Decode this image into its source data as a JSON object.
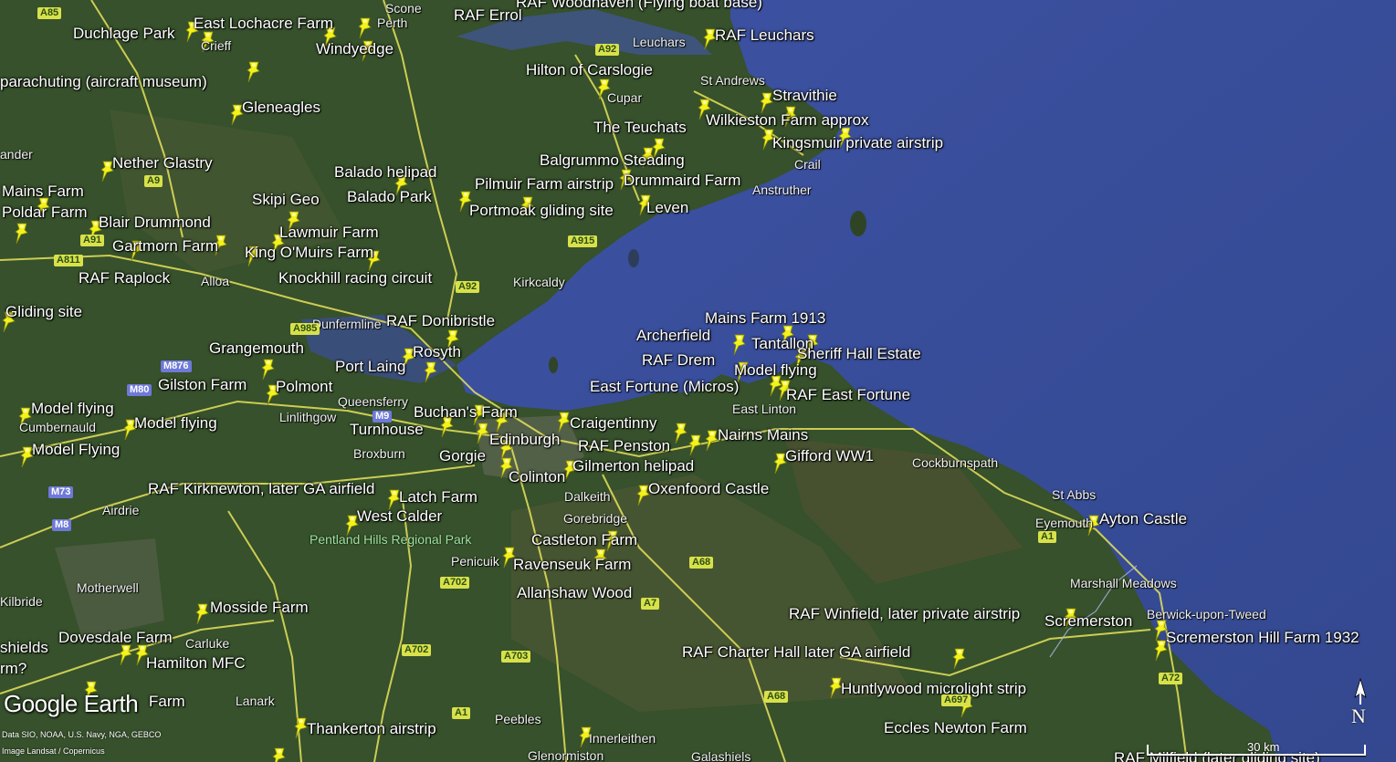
{
  "colors": {
    "sea": "#3a4f9e",
    "land": "#34502a",
    "pin": "#f3f21a",
    "road": "#ece85a"
  },
  "labels": [
    {
      "text": "Duchlage Park"
    },
    {
      "text": "East Lochacre Farm"
    },
    {
      "text": "Windyedge"
    },
    {
      "text": "RAF Errol"
    },
    {
      "text": "RAF Woodhaven (Flying boat base)"
    },
    {
      "text": "RAF Leuchars"
    },
    {
      "text": "Hilton of Carslogie"
    },
    {
      "text": "parachuting (aircraft museum)"
    },
    {
      "text": "Gleneagles"
    },
    {
      "text": "Stravithie"
    },
    {
      "text": "Wilkieston Farm approx"
    },
    {
      "text": "The Teuchats"
    },
    {
      "text": "Kingsmuir private airstrip"
    },
    {
      "text": "Nether Glastry"
    },
    {
      "text": "Balgrummo Steading"
    },
    {
      "text": "Balado helipad"
    },
    {
      "text": "Drummaird Farm"
    },
    {
      "text": "Pilmuir Farm airstrip"
    },
    {
      "text": "Mains Farm"
    },
    {
      "text": "Skipi Geo"
    },
    {
      "text": "Balado Park"
    },
    {
      "text": "Poldar Farm"
    },
    {
      "text": "Portmoak gliding site"
    },
    {
      "text": "Leven"
    },
    {
      "text": "Blair Drummond"
    },
    {
      "text": "Lawmuir Farm"
    },
    {
      "text": "Gartmorn Farm"
    },
    {
      "text": "King O'Muirs Farm"
    },
    {
      "text": "RAF Raplock"
    },
    {
      "text": "Knockhill racing circuit"
    },
    {
      "text": "Gliding site"
    },
    {
      "text": "Mains Farm 1913"
    },
    {
      "text": "RAF Donibristle"
    },
    {
      "text": "Archerfield"
    },
    {
      "text": "Tantallon"
    },
    {
      "text": "Grangemouth"
    },
    {
      "text": "Rosyth"
    },
    {
      "text": "RAF Drem"
    },
    {
      "text": "Sheriff Hall Estate"
    },
    {
      "text": "Port Laing"
    },
    {
      "text": "Model flying"
    },
    {
      "text": "Gilston Farm"
    },
    {
      "text": "Polmont"
    },
    {
      "text": "East Fortune (Micros)"
    },
    {
      "text": "RAF East Fortune"
    },
    {
      "text": "Model flying"
    },
    {
      "text": "Buchan's Farm"
    },
    {
      "text": "Model flying"
    },
    {
      "text": "Craigentinny"
    },
    {
      "text": "Turnhouse"
    },
    {
      "text": "Nairns Mains"
    },
    {
      "text": "Edinburgh"
    },
    {
      "text": "RAF Penston"
    },
    {
      "text": "Model Flying"
    },
    {
      "text": "Gorgie"
    },
    {
      "text": "Gifford WW1"
    },
    {
      "text": "Gilmerton helipad"
    },
    {
      "text": "Colinton"
    },
    {
      "text": "RAF Kirknewton, later GA airfield"
    },
    {
      "text": "Oxenfoord Castle"
    },
    {
      "text": "Latch Farm"
    },
    {
      "text": "West Calder"
    },
    {
      "text": "Ayton Castle"
    },
    {
      "text": "Castleton Farm"
    },
    {
      "text": "Ravenseuk Farm"
    },
    {
      "text": "Allanshaw Wood"
    },
    {
      "text": "Mosside Farm"
    },
    {
      "text": "RAF Winfield, later private airstrip"
    },
    {
      "text": "Scremerston"
    },
    {
      "text": "Dovesdale Farm"
    },
    {
      "text": "Scremerston Hill Farm 1932"
    },
    {
      "text": "Hamilton MFC"
    },
    {
      "text": "RAF Charter Hall later GA airfield"
    },
    {
      "text": "Huntlywood microlight strip"
    },
    {
      "text": "Farm"
    },
    {
      "text": "Thankerton airstrip"
    },
    {
      "text": "Eccles Newton Farm"
    },
    {
      "text": "RAF Milfield (later gliding site)"
    },
    {
      "text": "shields"
    },
    {
      "text": "rm?"
    }
  ],
  "towns": [
    {
      "text": "Scone"
    },
    {
      "text": "Perth"
    },
    {
      "text": "Crieff"
    },
    {
      "text": "Leuchars"
    },
    {
      "text": "St Andrews"
    },
    {
      "text": "Cupar"
    },
    {
      "text": "Crail"
    },
    {
      "text": "Anstruther"
    },
    {
      "text": "ander"
    },
    {
      "text": "Alloa"
    },
    {
      "text": "Kirkcaldy"
    },
    {
      "text": "Dunfermline"
    },
    {
      "text": "Queensferry"
    },
    {
      "text": "Linlithgow"
    },
    {
      "text": "Cumbernauld"
    },
    {
      "text": "Broxburn"
    },
    {
      "text": "East Linton"
    },
    {
      "text": "Dalkeith"
    },
    {
      "text": "Gorebridge"
    },
    {
      "text": "Cockburnspath"
    },
    {
      "text": "St Abbs"
    },
    {
      "text": "Eyemouth"
    },
    {
      "text": "Airdrie"
    },
    {
      "text": "Penicuik"
    },
    {
      "text": "Motherwell"
    },
    {
      "text": "Kilbride"
    },
    {
      "text": "Marshall Meadows"
    },
    {
      "text": "Berwick-upon-Tweed"
    },
    {
      "text": "Carluke"
    },
    {
      "text": "Lanark"
    },
    {
      "text": "Peebles"
    },
    {
      "text": "Innerleithen"
    },
    {
      "text": "Galashiels"
    },
    {
      "text": "Glenormiston"
    }
  ],
  "parks": [
    {
      "text": "Pentland Hills Regional Park"
    }
  ],
  "road_shields": [
    {
      "text": "A85",
      "type": "A"
    },
    {
      "text": "A92",
      "type": "A"
    },
    {
      "text": "A9",
      "type": "A"
    },
    {
      "text": "A91",
      "type": "A"
    },
    {
      "text": "A811",
      "type": "A"
    },
    {
      "text": "A915",
      "type": "A"
    },
    {
      "text": "A92",
      "type": "A"
    },
    {
      "text": "A985",
      "type": "A"
    },
    {
      "text": "M876",
      "type": "M"
    },
    {
      "text": "M80",
      "type": "M"
    },
    {
      "text": "M9",
      "type": "M"
    },
    {
      "text": "M73",
      "type": "M"
    },
    {
      "text": "M8",
      "type": "M"
    },
    {
      "text": "A702",
      "type": "A"
    },
    {
      "text": "A68",
      "type": "A"
    },
    {
      "text": "A7",
      "type": "A"
    },
    {
      "text": "A1",
      "type": "A"
    },
    {
      "text": "A702",
      "type": "A"
    },
    {
      "text": "A703",
      "type": "A"
    },
    {
      "text": "A1",
      "type": "A"
    },
    {
      "text": "A72",
      "type": "A"
    },
    {
      "text": "A68",
      "type": "A"
    },
    {
      "text": "A697",
      "type": "A"
    }
  ],
  "logo": "Google Earth",
  "credits": [
    "Data SIO, NOAA, U.S. Navy, NGA, GEBCO",
    "Image Landsat / Copernicus"
  ],
  "scale": "30 km",
  "compass": "N"
}
